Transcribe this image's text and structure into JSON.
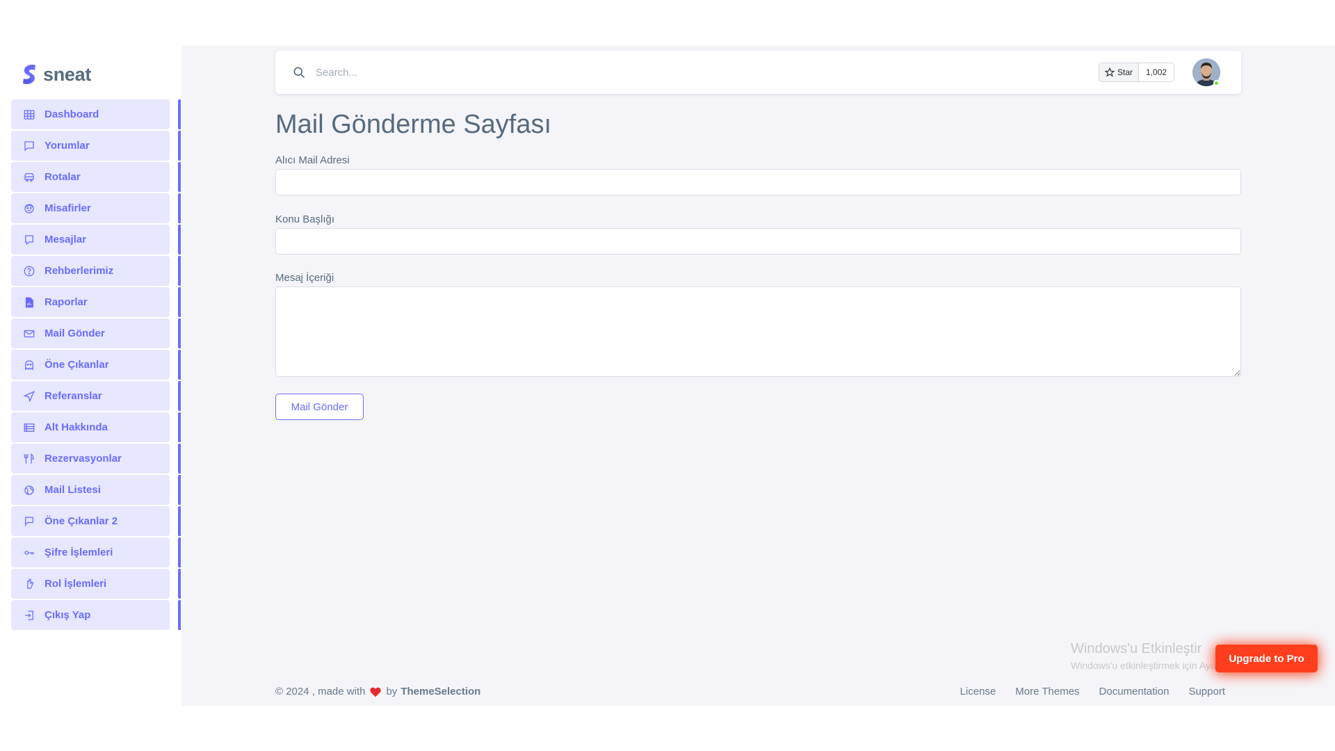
{
  "brand": {
    "name": "sneat"
  },
  "sidebar": {
    "items": [
      {
        "label": "Dashboard",
        "icon": "grid-icon"
      },
      {
        "label": "Yorumlar",
        "icon": "comment-icon"
      },
      {
        "label": "Rotalar",
        "icon": "bus-icon"
      },
      {
        "label": "Misafirler",
        "icon": "face-icon"
      },
      {
        "label": "Mesajlar",
        "icon": "message-icon"
      },
      {
        "label": "Rehberlerimiz",
        "icon": "help-circle-icon"
      },
      {
        "label": "Raporlar",
        "icon": "file-report-icon"
      },
      {
        "label": "Mail Gönder",
        "icon": "mail-send-icon"
      },
      {
        "label": "Öne Çıkanlar",
        "icon": "ghost-icon"
      },
      {
        "label": "Referanslar",
        "icon": "navigation-icon"
      },
      {
        "label": "Alt Hakkında",
        "icon": "list-box-icon"
      },
      {
        "label": "Rezervasyonlar",
        "icon": "restaurant-icon"
      },
      {
        "label": "Mail Listesi",
        "icon": "globe-icon"
      },
      {
        "label": "Öne Çıkanlar 2",
        "icon": "flag-icon"
      },
      {
        "label": "Şifre İşlemleri",
        "icon": "key-icon"
      },
      {
        "label": "Rol İşlemleri",
        "icon": "hand-icon"
      },
      {
        "label": "Çıkış Yap",
        "icon": "log-out-icon"
      }
    ]
  },
  "navbar": {
    "search_placeholder": "Search...",
    "star_label": "Star",
    "star_count": "1,002"
  },
  "main": {
    "title": "Mail Gönderme Sayfası",
    "fields": {
      "recipient_label": "Alıcı Mail Adresi",
      "recipient_value": "",
      "subject_label": "Konu Başlığı",
      "subject_value": "",
      "body_label": "Mesaj İçeriği",
      "body_value": ""
    },
    "send_button": "Mail Gönder"
  },
  "footer": {
    "copyright": "© 2024 , made with",
    "by": "by",
    "brand": "ThemeSelection",
    "links": [
      "License",
      "More Themes",
      "Documentation",
      "Support"
    ]
  },
  "watermark": {
    "title": "Windows'u Etkinleştir",
    "subtitle": "Windows'u etkinleştirmek için Ayarlar'a gidin."
  },
  "upgrade_button": "Upgrade to Pro",
  "colors": {
    "primary": "#696cff",
    "primary_light": "#e7e7ff",
    "text": "#566a7f",
    "background": "#f5f5f9",
    "upgrade": "#ff3e1d",
    "online": "#71dd37"
  }
}
